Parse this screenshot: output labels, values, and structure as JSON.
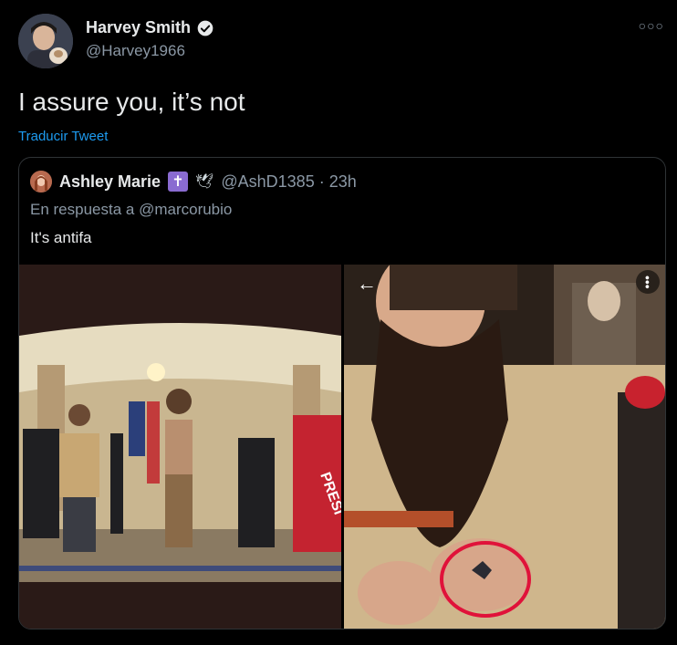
{
  "tweet": {
    "author_name": "Harvey Smith",
    "author_handle": "@Harvey1966",
    "text": "I assure you, it’s not",
    "translate_label": "Traducir Tweet",
    "more_icon": "more-horizontal-icon"
  },
  "quoted": {
    "author_name": "Ashley Marie",
    "badge_glyph": "✝",
    "dove_glyph": "🕊",
    "handle_time": "@AshD1385 · 23h",
    "reply_to": "En respuesta a @marcorubio",
    "text": "It's antifa",
    "banner_text": "PRESI"
  },
  "media": {
    "back_glyph": "←",
    "more_glyph": "•••"
  },
  "colors": {
    "background": "#000000",
    "accent": "#1d9bf0",
    "verified": "#e7e9ea",
    "circle_annotation": "#e0123a"
  }
}
